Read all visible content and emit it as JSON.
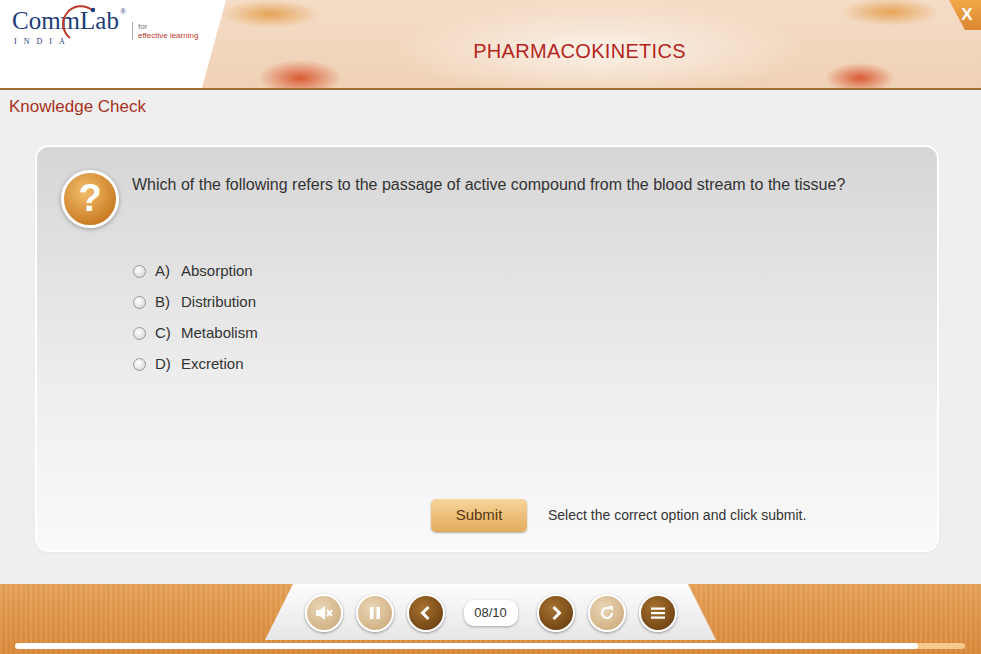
{
  "header": {
    "logo": {
      "word": "CommLab",
      "reg": "®",
      "country": "INDIA",
      "tag_1": "for",
      "tag_2": "effective learning"
    },
    "title": "PHARMACOKINETICS",
    "close": "X"
  },
  "section_title": "Knowledge Check",
  "question": {
    "icon": "?",
    "text": "Which of the following refers to the passage of active compound from the blood stream to the tissue?",
    "options": [
      {
        "letter": "A)",
        "label": "Absorption",
        "selected": false
      },
      {
        "letter": "B)",
        "label": "Distribution",
        "selected": false
      },
      {
        "letter": "C)",
        "label": "Metabolism",
        "selected": false
      },
      {
        "letter": "D)",
        "label": "Excretion",
        "selected": false
      }
    ]
  },
  "submit": "Submit",
  "instruction": "Select the correct option and click submit.",
  "player": {
    "buttons_left": [
      {
        "kind": "mute",
        "enabled": false
      },
      {
        "kind": "pause",
        "enabled": false
      },
      {
        "kind": "prev",
        "enabled": true
      }
    ],
    "page": "08/10",
    "buttons_right": [
      {
        "kind": "next",
        "enabled": true
      },
      {
        "kind": "replay",
        "enabled": false
      },
      {
        "kind": "menu",
        "enabled": true
      }
    ],
    "progress": {
      "level": 0.95
    }
  }
}
